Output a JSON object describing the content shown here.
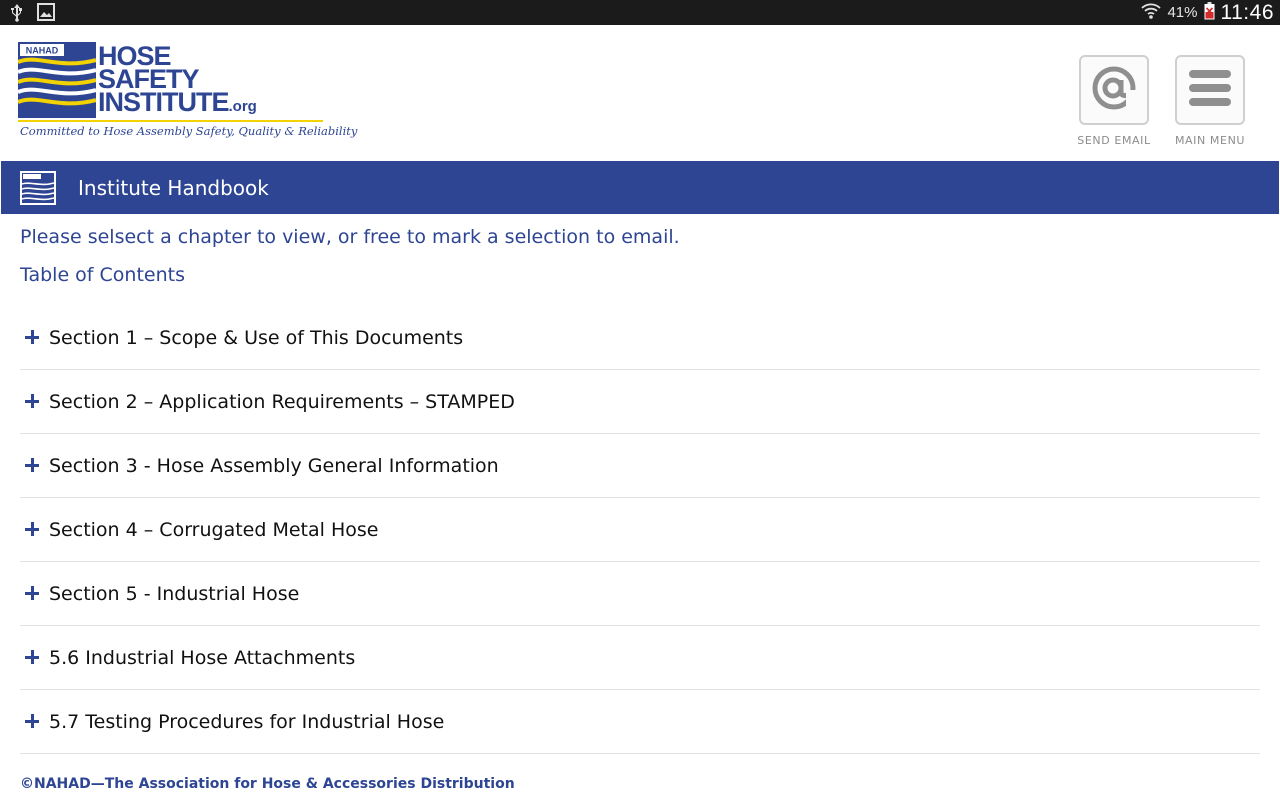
{
  "status_bar": {
    "battery_percent": "41%",
    "time": "11:46",
    "icons": [
      "usb-icon",
      "image-icon",
      "wifi-icon",
      "battery-charging-icon"
    ]
  },
  "header": {
    "logo": {
      "badge": "NAHAD",
      "line1": "HOSE",
      "line2": "SAFETY",
      "line3": "INSTITUTE",
      "org": ".org",
      "tagline": "Committed to Hose Assembly Safety, Quality & Reliability"
    },
    "send_email_label": "SEND EMAIL",
    "send_email_icon": "at-sign-icon",
    "main_menu_label": "MAIN MENU",
    "main_menu_icon": "hamburger-menu-icon"
  },
  "titlebar": {
    "title": "Institute Handbook",
    "icon": "nahad-wave-icon"
  },
  "content": {
    "intro": "Please selsect a chapter to view, or free to mark a selection to email.",
    "toc_heading": "Table of Contents",
    "sections": [
      {
        "label": "Section 1 – Scope & Use of This Documents"
      },
      {
        "label": "Section 2 – Application Requirements – STAMPED"
      },
      {
        "label": "Section 3 - Hose Assembly General Information"
      },
      {
        "label": "Section 4 – Corrugated Metal Hose"
      },
      {
        "label": "Section 5 - Industrial Hose"
      },
      {
        "label": "5.6 Industrial Hose Attachments"
      },
      {
        "label": "5.7 Testing Procedures for Industrial Hose"
      }
    ]
  },
  "footer": {
    "copyright": "©NAHAD—The Association for Hose & Accessories Distribution"
  },
  "colors": {
    "brand_blue": "#2d4593",
    "brand_yellow": "#f2d200",
    "status_bar": "#1b1b1b"
  }
}
